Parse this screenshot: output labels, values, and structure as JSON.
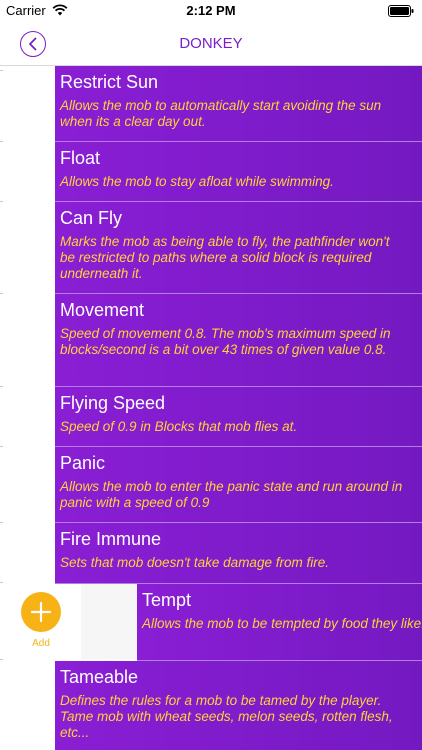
{
  "status_bar": {
    "carrier": "Carrier",
    "time": "2:12 PM"
  },
  "nav": {
    "title": "DONKEY",
    "back_icon": "chevron-left-circle-icon"
  },
  "accent_color": "#7a1fc8",
  "row_color": "#7d1bc9",
  "desc_color": "#ffd23a",
  "add_action": {
    "label": "Add",
    "color": "#f7b216",
    "icon": "plus-icon"
  },
  "behaviors": [
    {
      "title": "Restrict Sun",
      "description": "Allows the mob to automatically start avoiding the sun when its a clear day out."
    },
    {
      "title": "Float",
      "description": "Allows the mob to stay afloat while swimming."
    },
    {
      "title": "Can Fly",
      "description": "Marks the mob as being able to fly, the pathfinder won't be restricted to paths where a solid block is required underneath it."
    },
    {
      "title": "Movement",
      "description": "Speed of movement 0.8. The mob's maximum speed in blocks/second is a bit over 43 times of given value 0.8."
    },
    {
      "title": "Flying Speed",
      "description": "Speed of 0.9 in Blocks that mob flies at."
    },
    {
      "title": "Panic",
      "description": "Allows the mob to enter the panic state and run around in panic with a speed of 0.9"
    },
    {
      "title": "Fire Immune",
      "description": "Sets that mob doesn't take damage from fire."
    },
    {
      "title": "Tempt",
      "description": "Allows the mob to be tempted by food they like: wheat, sugar, melon seeds, etc.."
    },
    {
      "title": "Tameable",
      "description": "Defines the rules for a mob to be tamed by the player. Tame mob with wheat seeds, melon seeds, rotten flesh, etc..."
    }
  ]
}
